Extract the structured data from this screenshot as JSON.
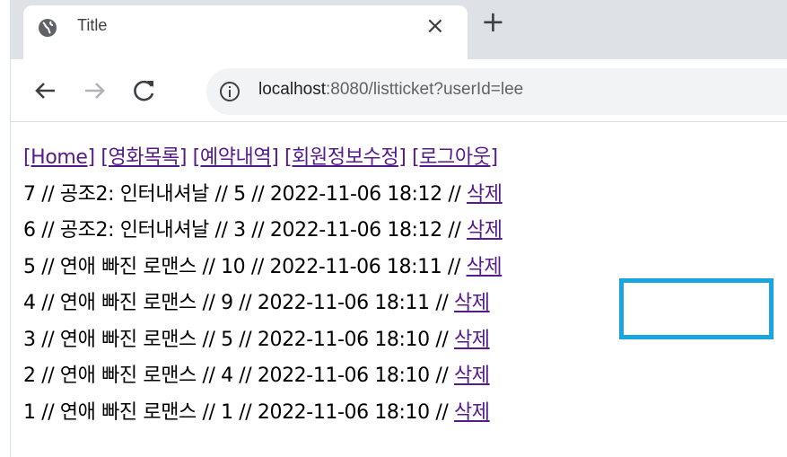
{
  "browser": {
    "tab_title": "Title",
    "tab_close_glyph": "×",
    "new_tab_glyph": "+",
    "url_host": "localhost",
    "url_rest": ":8080/listticket?userId=lee"
  },
  "nav": {
    "home": "[Home]",
    "movies": "[영화목록]",
    "reservations": "[예약내역]",
    "profile": "[회원정보수정]",
    "logout": "[로그아웃]"
  },
  "tickets": [
    {
      "text": "7 // 공조2: 인터내셔날 // 5 // 2022-11-06 18:12 // ",
      "delete": "삭제"
    },
    {
      "text": "6 // 공조2: 인터내셔날 // 3 // 2022-11-06 18:12 // ",
      "delete": "삭제"
    },
    {
      "text": "5 // 연애 빠진 로맨스 // 10 // 2022-11-06 18:11 // ",
      "delete": "삭제"
    },
    {
      "text": "4 // 연애 빠진 로맨스 // 9 // 2022-11-06 18:11 // ",
      "delete": "삭제"
    },
    {
      "text": "3 // 연애 빠진 로맨스 // 5 // 2022-11-06 18:10 // ",
      "delete": "삭제"
    },
    {
      "text": "2 // 연애 빠진 로맨스 // 4 // 2022-11-06 18:10 // ",
      "delete": "삭제"
    },
    {
      "text": "1 // 연애 빠진 로맨스 // 1 // 2022-11-06 18:10 // ",
      "delete": "삭제"
    }
  ],
  "colors": {
    "link": "#551a8b",
    "highlight": "#1aa4e0",
    "tabstrip": "#dee1e6"
  }
}
